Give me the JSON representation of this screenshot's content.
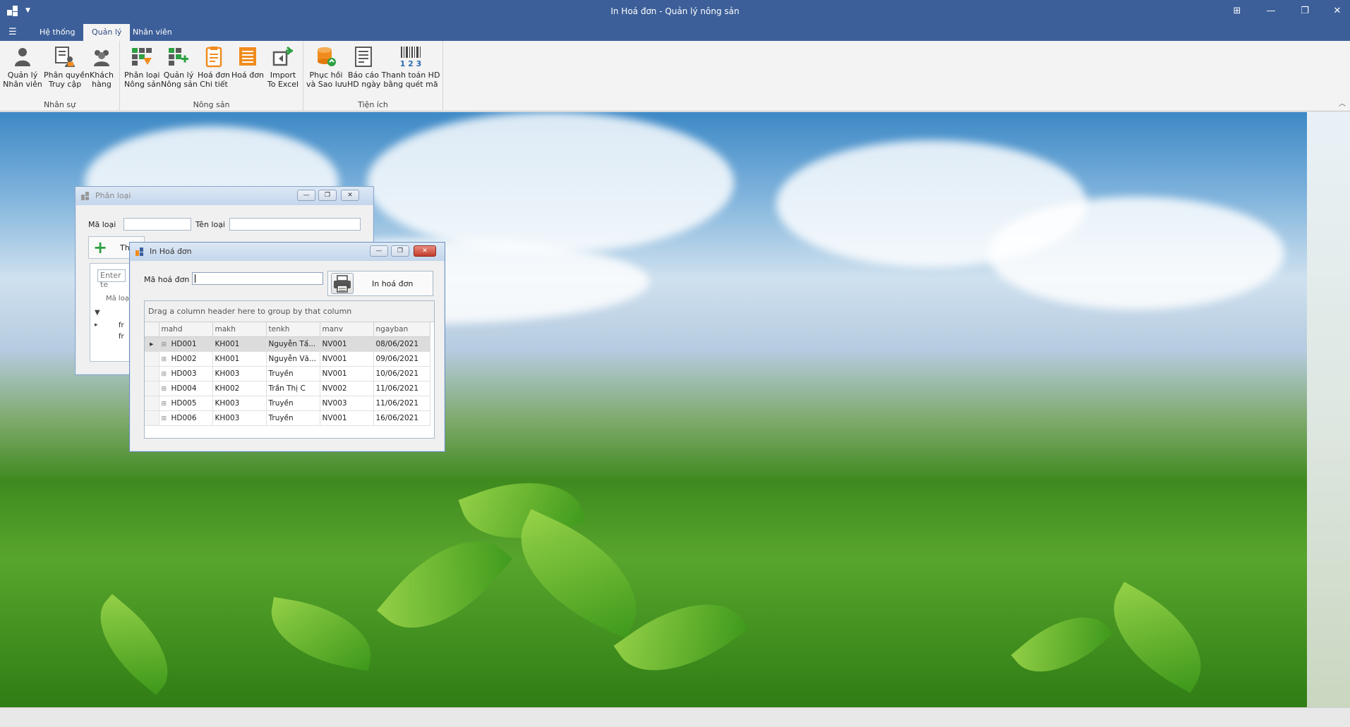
{
  "window": {
    "title": "In Hoá đơn - Quản lý nông sản",
    "min_glyph": "—",
    "restore_glyph": "❐",
    "close_glyph": "✕",
    "layout_glyph": "⊞"
  },
  "ribbon_tabs": [
    {
      "label": "Hệ thống",
      "active": false
    },
    {
      "label": "Quản lý",
      "active": true
    },
    {
      "label": "Nhân viên",
      "active": false
    }
  ],
  "ribbon": {
    "groups": [
      {
        "title": "Nhân sự",
        "buttons": [
          {
            "label1": "Quản lý",
            "label2": "Nhân viên",
            "icon": "user-icon"
          },
          {
            "label1": "Phân quyền",
            "label2": "Truy cập",
            "icon": "permission-icon"
          },
          {
            "label1": "Khách",
            "label2": "hàng",
            "icon": "customers-icon"
          }
        ]
      },
      {
        "title": "Nông sản",
        "buttons": [
          {
            "label1": "Phân loại",
            "label2": "Nông sản",
            "icon": "category-grid-icon"
          },
          {
            "label1": "Quản lý",
            "label2": "Nông sản",
            "icon": "product-grid-icon"
          },
          {
            "label1": "Hoá đơn",
            "label2": "Chi tiết",
            "icon": "clipboard-icon"
          },
          {
            "label1": "Hoá đơn",
            "label2": "",
            "icon": "invoice-icon"
          },
          {
            "label1": "Import",
            "label2": "To Excel",
            "icon": "import-icon"
          }
        ]
      },
      {
        "title": "Tiện ích",
        "buttons": [
          {
            "label1": "Phục hồi",
            "label2": "và Sao lưu",
            "icon": "database-icon"
          },
          {
            "label1": "Báo cáo",
            "label2": "HD ngày",
            "icon": "report-icon"
          },
          {
            "label1": "Thanh toán HD",
            "label2": "bằng quét mã",
            "icon": "barcode-icon"
          }
        ]
      }
    ]
  },
  "phanloai_window": {
    "title": "Phân loại",
    "ma_loai_label": "Mã loại",
    "ten_loai_label": "Tên loại",
    "add_label": "Th",
    "search_placeholder": "Enter te",
    "col_header": "Mã loạ",
    "row_text_1": "fr",
    "row_text_2": "fr"
  },
  "inhoadon_window": {
    "title": "In Hoá đơn",
    "ma_hoa_don_label": "Mã hoá đơn",
    "ma_hoa_don_value": "",
    "print_button_label": "In hoá đơn",
    "group_panel_text": "Drag a column header here to group by that column",
    "columns": [
      "mahd",
      "makh",
      "tenkh",
      "manv",
      "ngayban"
    ],
    "rows": [
      [
        "HD001",
        "KH001",
        "Nguyễn Tấ...",
        "NV001",
        "08/06/2021"
      ],
      [
        "HD002",
        "KH001",
        "Nguyễn Vă...",
        "NV001",
        "09/06/2021"
      ],
      [
        "HD003",
        "KH003",
        "Truyền",
        "NV001",
        "10/06/2021"
      ],
      [
        "HD004",
        "KH002",
        "Trần Thị C",
        "NV002",
        "11/06/2021"
      ],
      [
        "HD005",
        "KH003",
        "Truyền",
        "NV003",
        "11/06/2021"
      ],
      [
        "HD006",
        "KH003",
        "Truyền",
        "NV001",
        "16/06/2021"
      ]
    ]
  },
  "colors": {
    "titlebar": "#3c5f99",
    "ribbon": "#f3f3f3",
    "accent_orange": "#f08c1e",
    "accent_green": "#2ea043"
  }
}
